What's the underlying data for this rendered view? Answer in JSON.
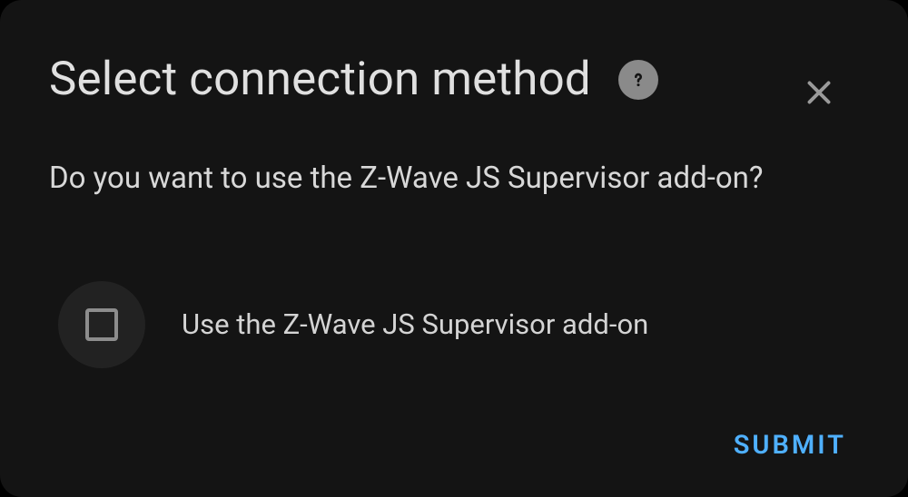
{
  "dialog": {
    "title": "Select connection method",
    "description": "Do you want to use the Z-Wave JS Supervisor add-on?",
    "checkbox": {
      "label": "Use the Z-Wave JS Supervisor add-on",
      "checked": false
    },
    "actions": {
      "submit_label": "SUBMIT"
    }
  },
  "colors": {
    "background": "#141414",
    "text": "#e0e0e0",
    "accent": "#4fb0ff"
  }
}
